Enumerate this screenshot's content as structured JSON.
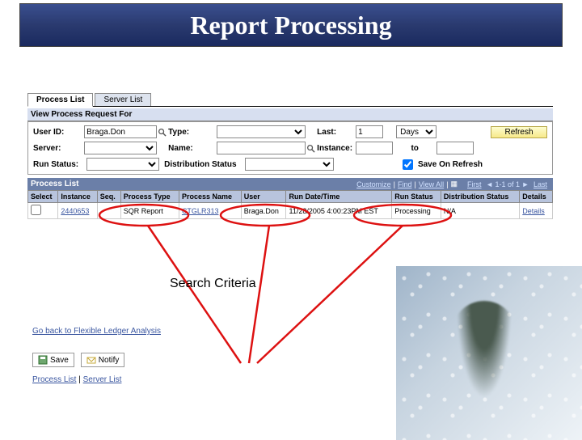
{
  "banner": {
    "title": "Report Processing"
  },
  "tabs": {
    "process_list": "Process List",
    "server_list": "Server List"
  },
  "section": {
    "view_for": "View Process Request For"
  },
  "criteria": {
    "user_id_label": "User ID:",
    "user_id_value": "Braga.Don",
    "type_label": "Type:",
    "last_label": "Last:",
    "last_value": "1",
    "last_unit_options": [
      "Days"
    ],
    "last_unit_value": "Days",
    "refresh_label": "Refresh",
    "server_label": "Server:",
    "name_label": "Name:",
    "instance_label": "Instance:",
    "to_label": "to",
    "run_status_label": "Run Status:",
    "dist_status_label": "Distribution Status",
    "save_on_refresh_label": "Save On Refresh",
    "save_on_refresh_checked": true
  },
  "listbar": {
    "title": "Process List",
    "customize": "Customize",
    "find": "Find",
    "view_all": "View All",
    "range": "1-1 of 1",
    "first": "First",
    "last": "Last"
  },
  "grid": {
    "headers": {
      "select": "Select",
      "instance": "Instance",
      "seq": "Seq.",
      "process_type": "Process Type",
      "process_name": "Process Name",
      "user": "User",
      "run_dt": "Run Date/Time",
      "run_status": "Run Status",
      "dist_status": "Distribution Status",
      "details": "Details"
    },
    "rows": [
      {
        "select": false,
        "instance": "2440653",
        "seq": "",
        "process_type": "SQR Report",
        "process_name": "CTGLR313",
        "user": "Braga.Don",
        "run_dt": "11/28/2005 4:00:23PM EST",
        "run_status": "Processing",
        "dist_status": "N/A",
        "details": "Details"
      }
    ]
  },
  "annotation": {
    "text": "Search Criteria"
  },
  "links": {
    "back": "Go back to Flexible Ledger Analysis"
  },
  "footer_buttons": {
    "save": "Save",
    "notify": "Notify"
  },
  "footer_links": {
    "process_list": "Process List",
    "server_list": "Server List"
  }
}
